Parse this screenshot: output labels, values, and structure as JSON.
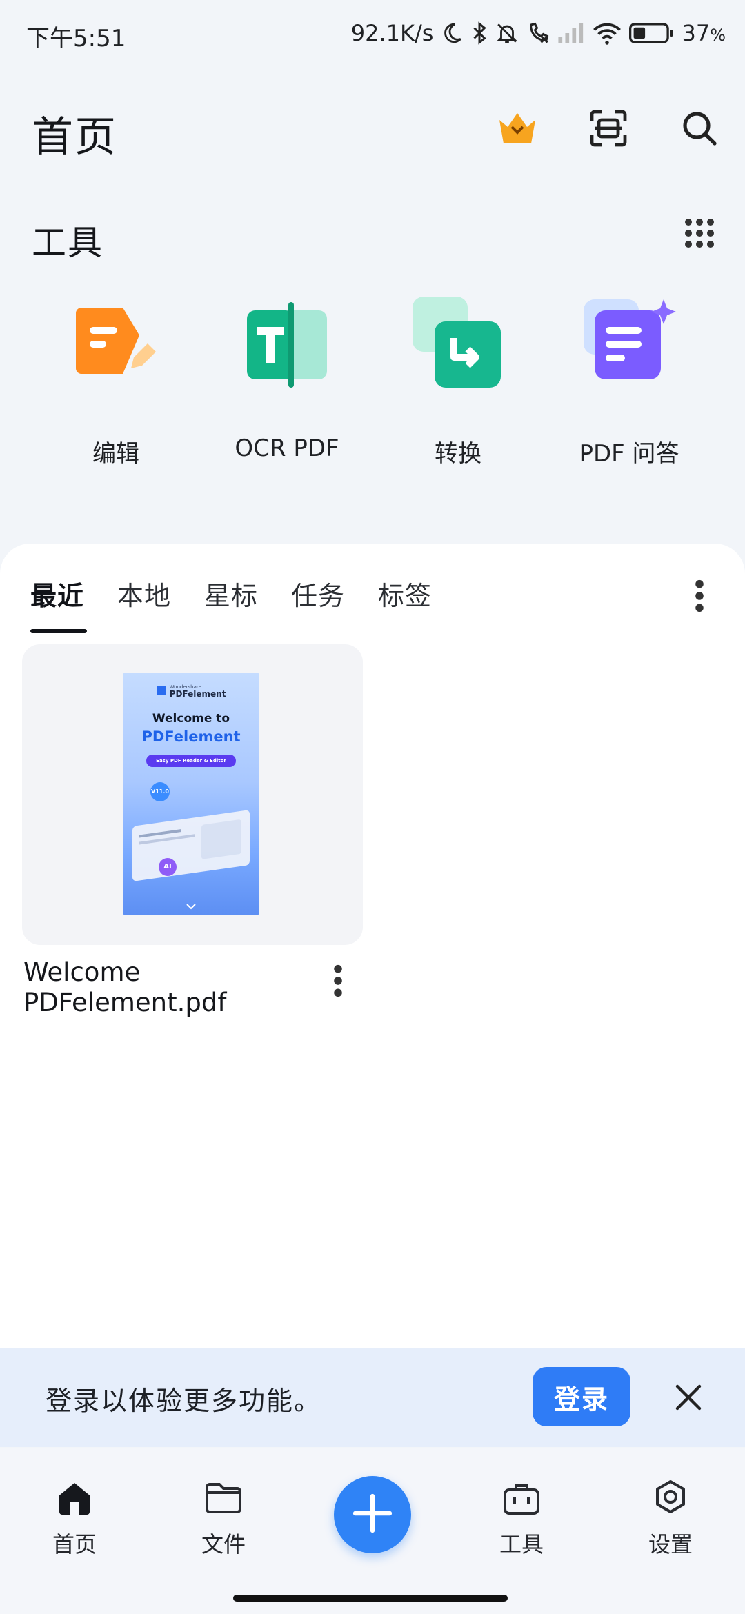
{
  "status_bar": {
    "time": "下午5:51",
    "network_speed": "92.1K/s",
    "battery": "37",
    "battery_unit": "%",
    "battery_level": 0.37,
    "icons": [
      "moon-icon",
      "bluetooth-icon",
      "mute-bell-icon",
      "call-icon",
      "signal-icon",
      "wifi-icon",
      "battery-icon"
    ]
  },
  "header": {
    "title": "首页",
    "icons": [
      "crown-icon",
      "scan-icon",
      "search-icon"
    ],
    "accent_color": "#f5a21f"
  },
  "tools": {
    "title": "工具",
    "items": [
      {
        "label": "编辑",
        "icon": "edit-icon",
        "color": "#ff8a1f"
      },
      {
        "label": "OCR PDF",
        "icon": "ocr-icon",
        "color": "#13b587"
      },
      {
        "label": "转换",
        "icon": "convert-icon",
        "color": "#18b991"
      },
      {
        "label": "PDF 问答",
        "icon": "pdf-qa-icon",
        "color": "#7b5cff"
      }
    ]
  },
  "files": {
    "tabs": [
      "最近",
      "本地",
      "星标",
      "任务",
      "标签"
    ],
    "active_tab": "最近",
    "items": [
      {
        "name_line1": "Welcome",
        "name_line2": "PDFelement.pdf",
        "thumb": {
          "brand_small": "Wondershare",
          "brand": "PDFelement",
          "headline1": "Welcome to",
          "headline2": "PDFelement",
          "pill": "Easy PDF Reader & Editor",
          "badge": "V11.0",
          "ai": "AI"
        }
      }
    ]
  },
  "login_banner": {
    "message": "登录以体验更多功能。",
    "button": "登录"
  },
  "bottom_nav": {
    "items": [
      {
        "label": "首页",
        "icon": "home-icon"
      },
      {
        "label": "文件",
        "icon": "folder-icon"
      },
      {
        "label": "工具",
        "icon": "toolbox-icon"
      },
      {
        "label": "设置",
        "icon": "settings-icon"
      }
    ],
    "fab_icon": "plus-icon",
    "primary_color": "#2f83f6"
  }
}
